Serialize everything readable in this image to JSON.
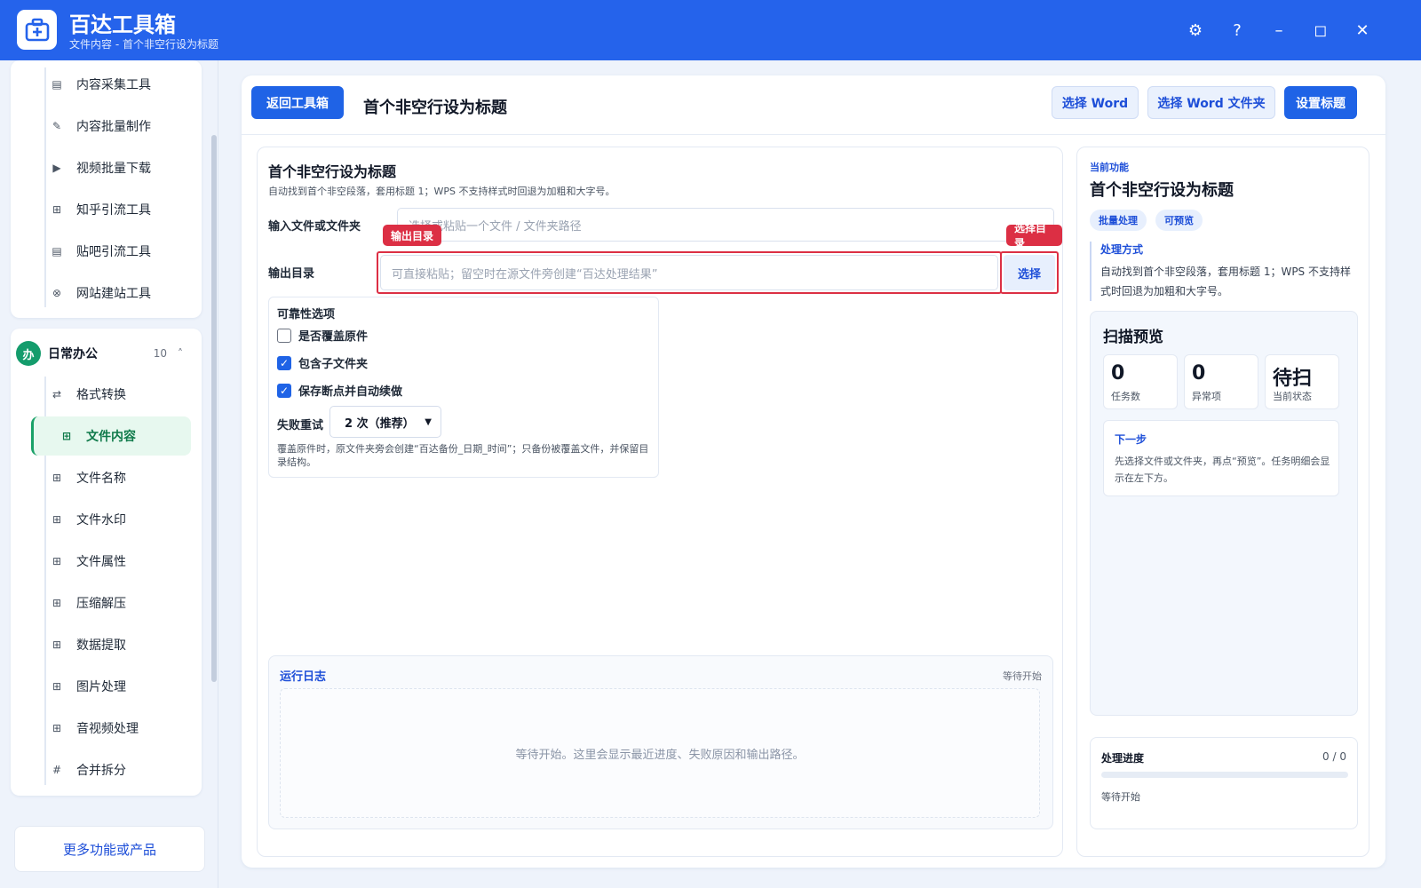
{
  "app": {
    "title": "百达工具箱",
    "subtitle": "文件内容 - 首个非空行设为标题"
  },
  "window_controls": [
    "⚙",
    "?",
    "–",
    "◻",
    "✕"
  ],
  "sidebar": {
    "top_items": [
      {
        "label": "内容采集工具",
        "icon": "▤"
      },
      {
        "label": "内容批量制作",
        "icon": "✎"
      },
      {
        "label": "视频批量下载",
        "icon": "▶"
      },
      {
        "label": "知乎引流工具",
        "icon": "⊞"
      },
      {
        "label": "贴吧引流工具",
        "icon": "▤"
      },
      {
        "label": "网站建站工具",
        "icon": "⊗"
      }
    ],
    "group": {
      "badge": "办",
      "title": "日常办公",
      "count": "10",
      "caret": "˄"
    },
    "group_items": [
      {
        "label": "格式转换",
        "icon": "⇄"
      },
      {
        "label": "文件内容",
        "icon": "⊞",
        "active": true
      },
      {
        "label": "文件名称",
        "icon": "⊞"
      },
      {
        "label": "文件水印",
        "icon": "⊞"
      },
      {
        "label": "文件属性",
        "icon": "⊞"
      },
      {
        "label": "压缩解压",
        "icon": "⊞"
      },
      {
        "label": "数据提取",
        "icon": "⊞"
      },
      {
        "label": "图片处理",
        "icon": "⊞"
      },
      {
        "label": "音视频处理",
        "icon": "⊞"
      },
      {
        "label": "合并拆分",
        "icon": "#"
      }
    ],
    "more_label": "更多功能或产品"
  },
  "header": {
    "back_label": "返回工具箱",
    "title": "首个非空行设为标题",
    "select_word": "选择 Word",
    "select_word_folder": "选择 Word 文件夹",
    "set_title": "设置标题"
  },
  "form": {
    "title": "首个非空行设为标题",
    "desc": "自动找到首个非空段落，套用标题 1；WPS 不支持样式时回退为加粗和大字号。",
    "input_label": "输入文件或文件夹",
    "input_placeholder": "选择或粘贴一个文件 / 文件夹路径",
    "output_label": "输出目录",
    "output_placeholder": "可直接粘贴；留空时在源文件旁创建“百达处理结果”",
    "tag_output": "输出目录",
    "tag_select": "选择目录",
    "select_btn": "选择",
    "options_title": "可靠性选项",
    "options": [
      {
        "label": "是否覆盖原件",
        "checked": false
      },
      {
        "label": "包含子文件夹",
        "checked": true
      },
      {
        "label": "保存断点并自动续做",
        "checked": true
      }
    ],
    "retry_label": "失败重试",
    "retry_value": "2 次（推荐）",
    "note": "覆盖原件时，原文件夹旁会创建“百达备份_日期_时间”；只备份被覆盖文件，并保留目录结构。"
  },
  "log": {
    "title": "运行日志",
    "status": "等待开始",
    "body": "等待开始。这里会显示最近进度、失败原因和输出路径。"
  },
  "panel": {
    "small_label": "当前功能",
    "title": "首个非空行设为标题",
    "pills": [
      "批量处理",
      "可预览"
    ],
    "method_title": "处理方式",
    "method_text": "自动找到首个非空段落，套用标题 1；WPS 不支持样式时回退为加粗和大字号。",
    "scan_title": "扫描预览",
    "stats": [
      {
        "value": "0",
        "label": "任务数"
      },
      {
        "value": "0",
        "label": "异常项"
      },
      {
        "value": "待扫",
        "label": "当前状态"
      }
    ],
    "next_title": "下一步",
    "next_text": "先选择文件或文件夹，再点“预览”。任务明细会显示在左下方。",
    "progress_title": "处理进度",
    "progress_count": "0 / 0",
    "progress_fraction": 0,
    "progress_status": "等待开始"
  },
  "colors": {
    "accent": "#1f63e6",
    "titlebar": "#2563eb",
    "highlight": "#dc2f44",
    "active_green": "#149c6c"
  }
}
